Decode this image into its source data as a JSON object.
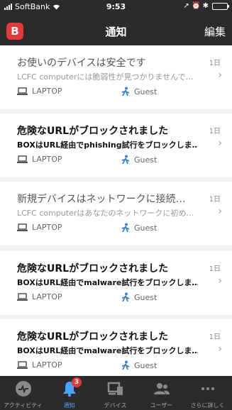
{
  "status_bar": {
    "carrier": "SoftBank",
    "time": "9:53",
    "indicators": "↗ ⏰ ✱",
    "battery_level": 1.0
  },
  "nav": {
    "logo_letter": "B",
    "title": "通知",
    "edit_label": "編集"
  },
  "notifications": [
    {
      "state": "read",
      "title": "お使いのデバイスは安全です",
      "body": "LCFC computerには脆弱性が見つかりませんで…",
      "time": "1日",
      "device": "LAPTOP",
      "user": "Guest"
    },
    {
      "state": "unread",
      "title": "危険なURLがブロックされました",
      "body": "BOXはURL経由でphishing試行をブロックしま…",
      "time": "1日",
      "device": "LAPTOP",
      "user": "Guest"
    },
    {
      "state": "read",
      "title": "新規デバイスはネットワークに接続…",
      "body": "LCFC computerはあなたのネットワークに初め…",
      "time": "1日",
      "device": "LAPTOP",
      "user": "Guest"
    },
    {
      "state": "unread",
      "title": "危険なURLがブロックされました",
      "body": "BOXはURL経由でmalware試行をブロックしま…",
      "time": "1日",
      "device": "LAPTOP",
      "user": "Guest"
    },
    {
      "state": "unread",
      "title": "危険なURLがブロックされました",
      "body": "BOXはURL経由でmalware試行をブロックしま…",
      "time": "1日",
      "device": "LAPTOP",
      "user": "Guest"
    }
  ],
  "tabs": [
    {
      "label": "アクティビティ",
      "icon": "activity-icon",
      "active": false
    },
    {
      "label": "通知",
      "icon": "bell-icon",
      "active": true,
      "badge": "3"
    },
    {
      "label": "デバイス",
      "icon": "devices-icon",
      "active": false
    },
    {
      "label": "ユーザー",
      "icon": "users-icon",
      "active": false
    },
    {
      "label": "さらに詳しく",
      "icon": "more-icon",
      "active": false
    }
  ],
  "colors": {
    "header_bg": "#2b2b2b",
    "brand_red": "#e23a3a",
    "active_tab": "#4ea2ff",
    "guest_icon": "#3a86c8"
  }
}
